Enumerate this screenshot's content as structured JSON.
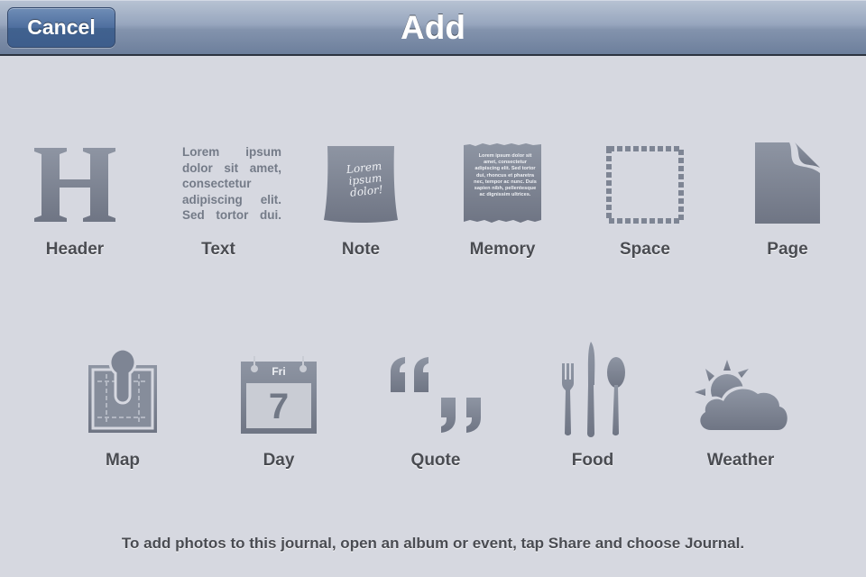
{
  "navbar": {
    "title": "Add",
    "cancel_label": "Cancel"
  },
  "colors": {
    "background": "#d6d8e0",
    "icon_gray": "#7e8594",
    "label_text": "#4a4c52",
    "nav_button": "#4f6f9f"
  },
  "items_row1": [
    {
      "id": "header",
      "label": "Header",
      "icon": "header-h-icon"
    },
    {
      "id": "text",
      "label": "Text",
      "icon": "text-lorem-icon",
      "preview_lines": [
        "Lorem ipsum",
        "dolor sit amet,",
        "consectetur",
        "adipiscing elit.",
        "Sed tortor dui."
      ]
    },
    {
      "id": "note",
      "label": "Note",
      "icon": "note-icon",
      "preview_text": "Lorem ipsum dolor!"
    },
    {
      "id": "memory",
      "label": "Memory",
      "icon": "memory-icon",
      "preview_text": "Lorem ipsum dolor sit amet, consectetur adipiscing elit. Sed tortor dui, rhoncus et pharetra nec, tempor ac nunc. Duis sapien nibh, pellentesque ac dignissim ultrices."
    },
    {
      "id": "space",
      "label": "Space",
      "icon": "dashed-square-icon"
    },
    {
      "id": "page",
      "label": "Page",
      "icon": "page-curl-icon"
    }
  ],
  "items_row2": [
    {
      "id": "map",
      "label": "Map",
      "icon": "map-pin-icon"
    },
    {
      "id": "day",
      "label": "Day",
      "icon": "calendar-icon",
      "day_name": "Fri",
      "day_number": "7"
    },
    {
      "id": "quote",
      "label": "Quote",
      "icon": "quote-marks-icon"
    },
    {
      "id": "food",
      "label": "Food",
      "icon": "cutlery-icon"
    },
    {
      "id": "weather",
      "label": "Weather",
      "icon": "sun-cloud-icon"
    }
  ],
  "footer": {
    "hint": "To add photos to this journal, open an album or event, tap Share and choose Journal."
  }
}
